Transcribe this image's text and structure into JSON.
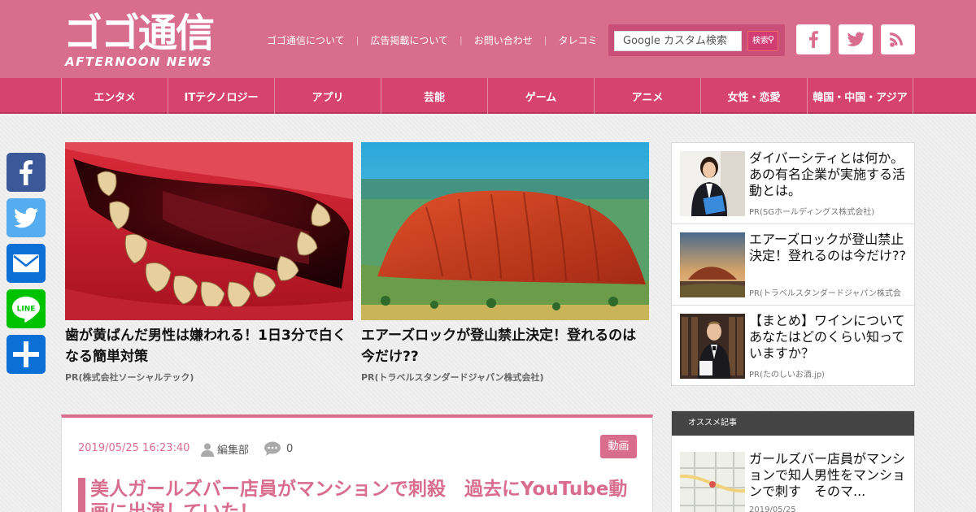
{
  "site": {
    "logo_main": "ゴゴ通信",
    "logo_sub": "AFTERNOON NEWS"
  },
  "topnav": [
    {
      "label": "ゴゴ通信について"
    },
    {
      "label": "広告掲載について"
    },
    {
      "label": "お問い合わせ"
    },
    {
      "label": "タレコミ"
    }
  ],
  "search": {
    "placeholder": "Google カスタム検索",
    "button_label": "検索"
  },
  "colors": {
    "header": "#d86d8e",
    "nav": "#d6436f",
    "accent": "#d86d8e",
    "facebook": "#3b5998",
    "twitter": "#55acee",
    "email": "#0b6fd8",
    "line": "#00c300"
  },
  "social_top": [
    "facebook-icon",
    "twitter-icon",
    "rss-icon"
  ],
  "categories": [
    {
      "label": "エンタメ"
    },
    {
      "label": "ITテクノロジー"
    },
    {
      "label": "アプリ"
    },
    {
      "label": "芸能"
    },
    {
      "label": "ゲーム"
    },
    {
      "label": "アニメ"
    },
    {
      "label": "女性・恋愛"
    },
    {
      "label": "韓国・中国・アジア"
    }
  ],
  "share_side": [
    "facebook-icon",
    "twitter-icon",
    "email-icon",
    "line-icon",
    "share-icon"
  ],
  "share_line_label": "LINE",
  "features": [
    {
      "title": "歯が黄ばんだ男性は嫌われる！1日3分で白くなる簡単対策",
      "pr": "PR(株式会社ソーシャルテック)"
    },
    {
      "title": "エアーズロックが登山禁止決定！登れるのは今だけ??",
      "pr": "PR(トラベルスタンダードジャパン株式会社)"
    }
  ],
  "ads": [
    {
      "title": "ダイバーシティとは何か。あの有名企業が実施する活動とは。",
      "pr": "PR(SGホールディングス株式会社)"
    },
    {
      "title": "エアーズロックが登山禁止決定！登れるのは今だけ??",
      "pr": "PR(トラベルスタンダードジャパン株式会"
    },
    {
      "title": "【まとめ】ワインについてあなたはどのくらい知っていますか？",
      "pr": "PR(たのしいお酒.jp)"
    }
  ],
  "article": {
    "date": "2019/05/25 16:23:40",
    "author": "編集部",
    "comments": "0",
    "tag": "動画",
    "title": "美人ガールズバー店員がマンションで刺殺　過去にYouTube動画に出演していた！"
  },
  "recommend": {
    "heading": "オススメ記事",
    "title": "ガールズバー店員がマンションで知人男性をマンションで刺す　そのマ...",
    "date": "2019/05/25"
  }
}
